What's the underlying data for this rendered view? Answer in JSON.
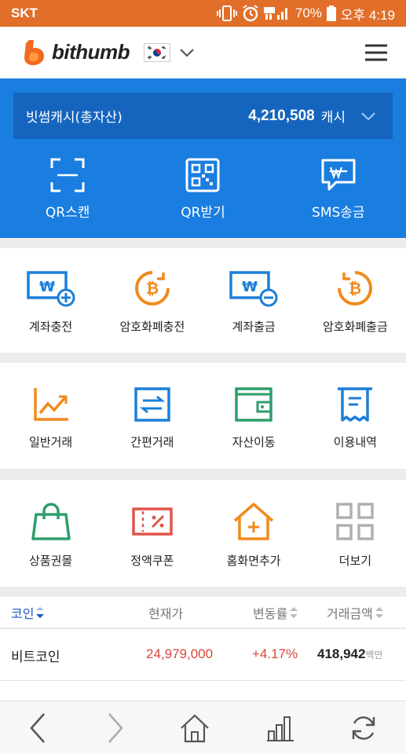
{
  "status_bar": {
    "carrier": "SKT",
    "battery": "70%",
    "time": "오후 4:19"
  },
  "header": {
    "logo_text": "bithumb",
    "country": "KR",
    "menu_icon": "hamburger-icon"
  },
  "cash": {
    "label": "빗썸캐시(총자산)",
    "amount": "4,210,508",
    "unit": "캐시"
  },
  "quick_actions": [
    {
      "label": "QR스캔",
      "icon": "qr-scan-icon"
    },
    {
      "label": "QR받기",
      "icon": "qr-code-icon"
    },
    {
      "label": "SMS송금",
      "icon": "sms-won-icon"
    }
  ],
  "row1": [
    {
      "label": "계좌충전",
      "icon": "won-deposit-icon"
    },
    {
      "label": "암호화폐충전",
      "icon": "crypto-deposit-icon"
    },
    {
      "label": "계좌출금",
      "icon": "won-withdraw-icon"
    },
    {
      "label": "암호화폐출금",
      "icon": "crypto-withdraw-icon"
    }
  ],
  "row2": [
    {
      "label": "일반거래",
      "icon": "chart-line-icon"
    },
    {
      "label": "간편거래",
      "icon": "exchange-icon"
    },
    {
      "label": "자산이동",
      "icon": "wallet-icon"
    },
    {
      "label": "이용내역",
      "icon": "receipt-icon"
    }
  ],
  "row3": [
    {
      "label": "상품권몰",
      "icon": "shopping-bag-icon"
    },
    {
      "label": "정액쿠폰",
      "icon": "coupon-icon"
    },
    {
      "label": "홈화면추가",
      "icon": "home-add-icon"
    },
    {
      "label": "더보기",
      "icon": "grid-more-icon"
    }
  ],
  "table": {
    "headers": [
      "코인",
      "현재가",
      "변동률",
      "거래금액"
    ],
    "rows": [
      {
        "name": "비트코인",
        "price": "24,979,000",
        "change": "+4.17%",
        "volume": "418,942",
        "volume_unit": "백만"
      }
    ]
  },
  "colors": {
    "status_bar": "#e16f2a",
    "primary_blue": "#1a7de0",
    "icon_blue": "#1b7fd8",
    "icon_orange": "#f08a1c",
    "icon_green": "#2e9e6b",
    "price_red": "#d9453a"
  }
}
